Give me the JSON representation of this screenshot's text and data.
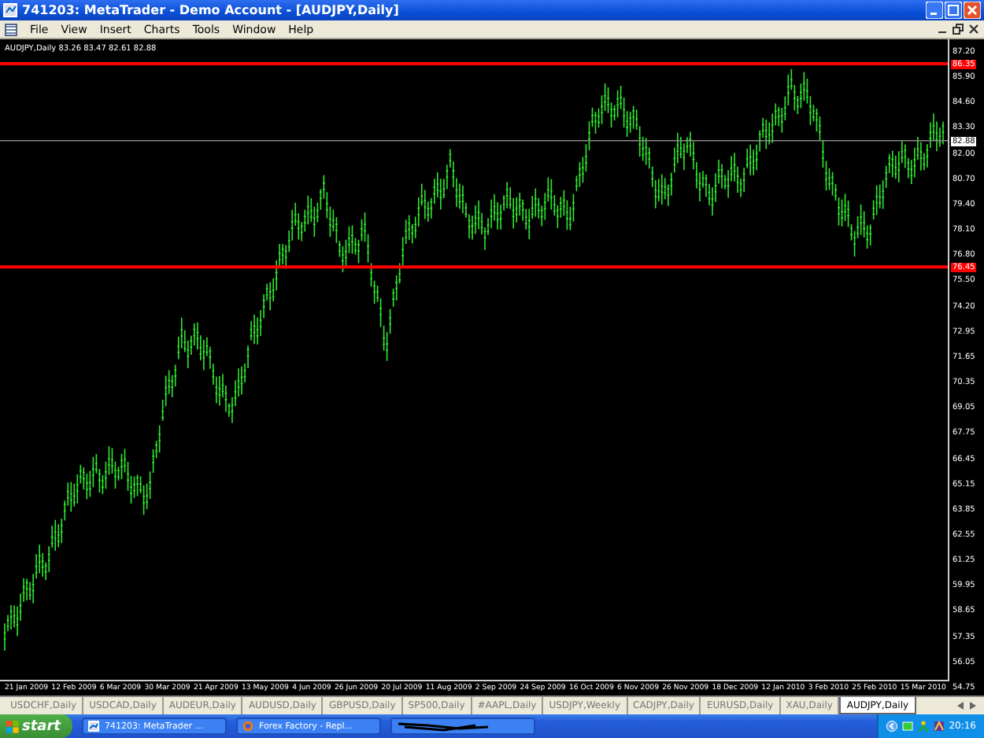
{
  "window": {
    "title": "741203: MetaTrader - Demo Account - [AUDJPY,Daily]"
  },
  "menu": [
    "File",
    "View",
    "Insert",
    "Charts",
    "Tools",
    "Window",
    "Help"
  ],
  "chart": {
    "header": "AUDJPY,Daily 83.26 83.47 82.61 82.88",
    "price_axis": [
      "87.20",
      "85.90",
      "84.60",
      "83.30",
      "82.00",
      "80.70",
      "79.40",
      "78.10",
      "76.80",
      "75.50",
      "74.20",
      "72.95",
      "71.65",
      "70.35",
      "69.05",
      "67.75",
      "66.45",
      "65.15",
      "63.85",
      "62.55",
      "61.25",
      "59.95",
      "58.65",
      "57.35",
      "56.05",
      "54.75"
    ],
    "price_tags": [
      {
        "label": "86.35",
        "kind": "level"
      },
      {
        "label": "82.88",
        "kind": "bid"
      },
      {
        "label": "76.45",
        "kind": "level"
      }
    ],
    "dates": [
      "21 Jan 2009",
      "12 Feb 2009",
      "6 Mar 2009",
      "30 Mar 2009",
      "21 Apr 2009",
      "13 May 2009",
      "4 Jun 2009",
      "26 Jun 2009",
      "20 Jul 2009",
      "11 Aug 2009",
      "2 Sep 2009",
      "24 Sep 2009",
      "16 Oct 2009",
      "6 Nov 2009",
      "26 Nov 2009",
      "18 Dec 2009",
      "12 Jan 2010",
      "3 Feb 2010",
      "25 Feb 2010",
      "15 Mar 2010"
    ]
  },
  "tabs": [
    {
      "label": "USDCHF,Daily",
      "selected": false
    },
    {
      "label": "USDCAD,Daily",
      "selected": false
    },
    {
      "label": "AUDEUR,Daily",
      "selected": false
    },
    {
      "label": "AUDUSD,Daily",
      "selected": false
    },
    {
      "label": "GBPUSD,Daily",
      "selected": false
    },
    {
      "label": "SP500,Daily",
      "selected": false
    },
    {
      "label": "#AAPL,Daily",
      "selected": false
    },
    {
      "label": "USDJPY,Weekly",
      "selected": false
    },
    {
      "label": "CADJPY,Daily",
      "selected": false
    },
    {
      "label": "EURUSD,Daily",
      "selected": false
    },
    {
      "label": "XAU,Daily",
      "selected": false
    },
    {
      "label": "AUDJPY,Daily",
      "selected": true
    }
  ],
  "taskbar": {
    "start": "start",
    "buttons": [
      {
        "label": "741203: MetaTrader ...",
        "kind": "metatrader"
      },
      {
        "label": "Forex Factory - Repl...",
        "kind": "browser"
      },
      {
        "kind": "hidden"
      }
    ],
    "clock": "20:16"
  }
}
